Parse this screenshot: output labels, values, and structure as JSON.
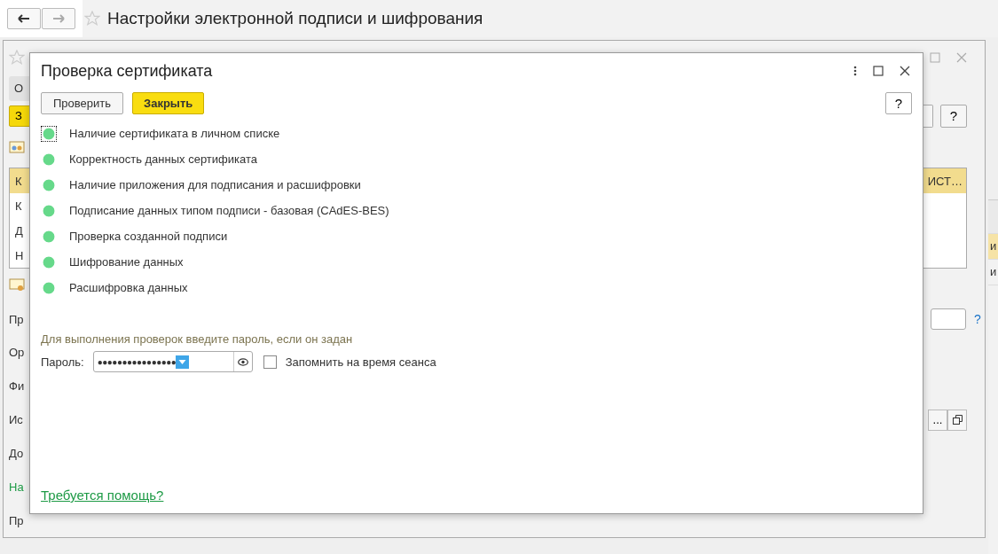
{
  "app": {
    "title": "Настройки электронной подписи и шифрования"
  },
  "background_window": {
    "tab": "О",
    "button": "З",
    "list_rows": [
      {
        "left": "К",
        "right": "ИСТ…",
        "selected": true
      },
      {
        "left": "К",
        "right": "",
        "selected": false
      },
      {
        "left": "Д",
        "right": "",
        "selected": false
      },
      {
        "left": "Н",
        "right": "",
        "selected": false
      }
    ],
    "help_button": "?",
    "field_help": "?",
    "field_button": "...",
    "labels": [
      {
        "text": "Пр",
        "kind": "label"
      },
      {
        "text": "Ор",
        "kind": "label"
      },
      {
        "text": "Фи",
        "kind": "label"
      },
      {
        "text": "Ис",
        "kind": "label"
      },
      {
        "text": "До",
        "kind": "label"
      },
      {
        "text": "На",
        "kind": "section"
      },
      {
        "text": "Пр",
        "kind": "label"
      }
    ]
  },
  "side_window": {
    "rows": [
      {
        "text": "и",
        "selected": true
      },
      {
        "text": "и",
        "selected": false
      }
    ]
  },
  "dialog": {
    "title": "Проверка сертификата",
    "buttons": [
      {
        "label": "Проверить",
        "kind": "default"
      },
      {
        "label": "Закрыть",
        "kind": "primary"
      }
    ],
    "help": "?",
    "checks": [
      {
        "label": "Наличие сертификата в личном списке",
        "color": "#66d98a",
        "focused": true
      },
      {
        "label": "Корректность данных сертификата",
        "color": "#66d98a",
        "focused": false
      },
      {
        "label": "Наличие приложения для подписания и расшифровки",
        "color": "#66d98a",
        "focused": false
      },
      {
        "label": "Подписание данных типом подписи - базовая (CAdES-BES)",
        "color": "#66d98a",
        "focused": false
      },
      {
        "label": "Проверка созданной подписи",
        "color": "#66d98a",
        "focused": false
      },
      {
        "label": "Шифрование данных",
        "color": "#66d98a",
        "focused": false
      },
      {
        "label": "Расшифровка данных",
        "color": "#66d98a",
        "focused": false
      }
    ],
    "hint": "Для выполнения проверок введите пароль, если он задан",
    "password": {
      "label": "Пароль:",
      "value": "●●●●●●●●●●●●●●●●"
    },
    "remember": {
      "label": "Запомнить на время сеанса",
      "checked": false
    },
    "help_link": "Требуется помощь?"
  }
}
